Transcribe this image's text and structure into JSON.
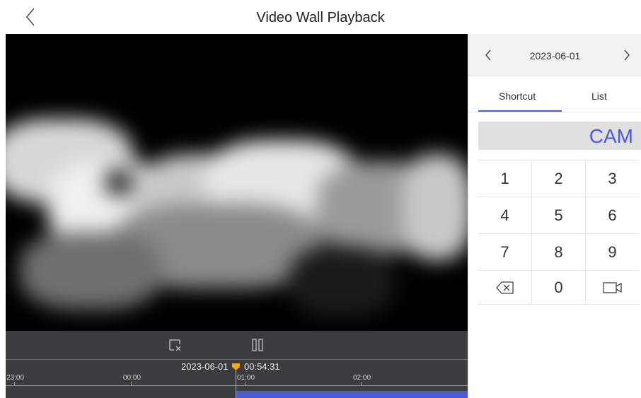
{
  "header": {
    "title": "Video Wall Playback"
  },
  "controls": {
    "icons": [
      "close-window-icon",
      "pause-icon"
    ]
  },
  "timeline": {
    "current_date": "2023-06-01",
    "current_time": "00:54:31",
    "ticks": [
      "23:00",
      "00:00",
      "01:00",
      "02:00"
    ]
  },
  "side_panel": {
    "date": "2023-06-01",
    "tabs": {
      "shortcut": "Shortcut",
      "list": "List"
    },
    "active_tab": "Shortcut",
    "display": "CAM",
    "keys": [
      [
        "1",
        "2",
        "3"
      ],
      [
        "4",
        "5",
        "6"
      ],
      [
        "7",
        "8",
        "9"
      ]
    ],
    "zero": "0"
  },
  "colors": {
    "accent": "#4b5bd6",
    "playhead": "#f5a623",
    "panel_bg": "#3a3c40"
  }
}
